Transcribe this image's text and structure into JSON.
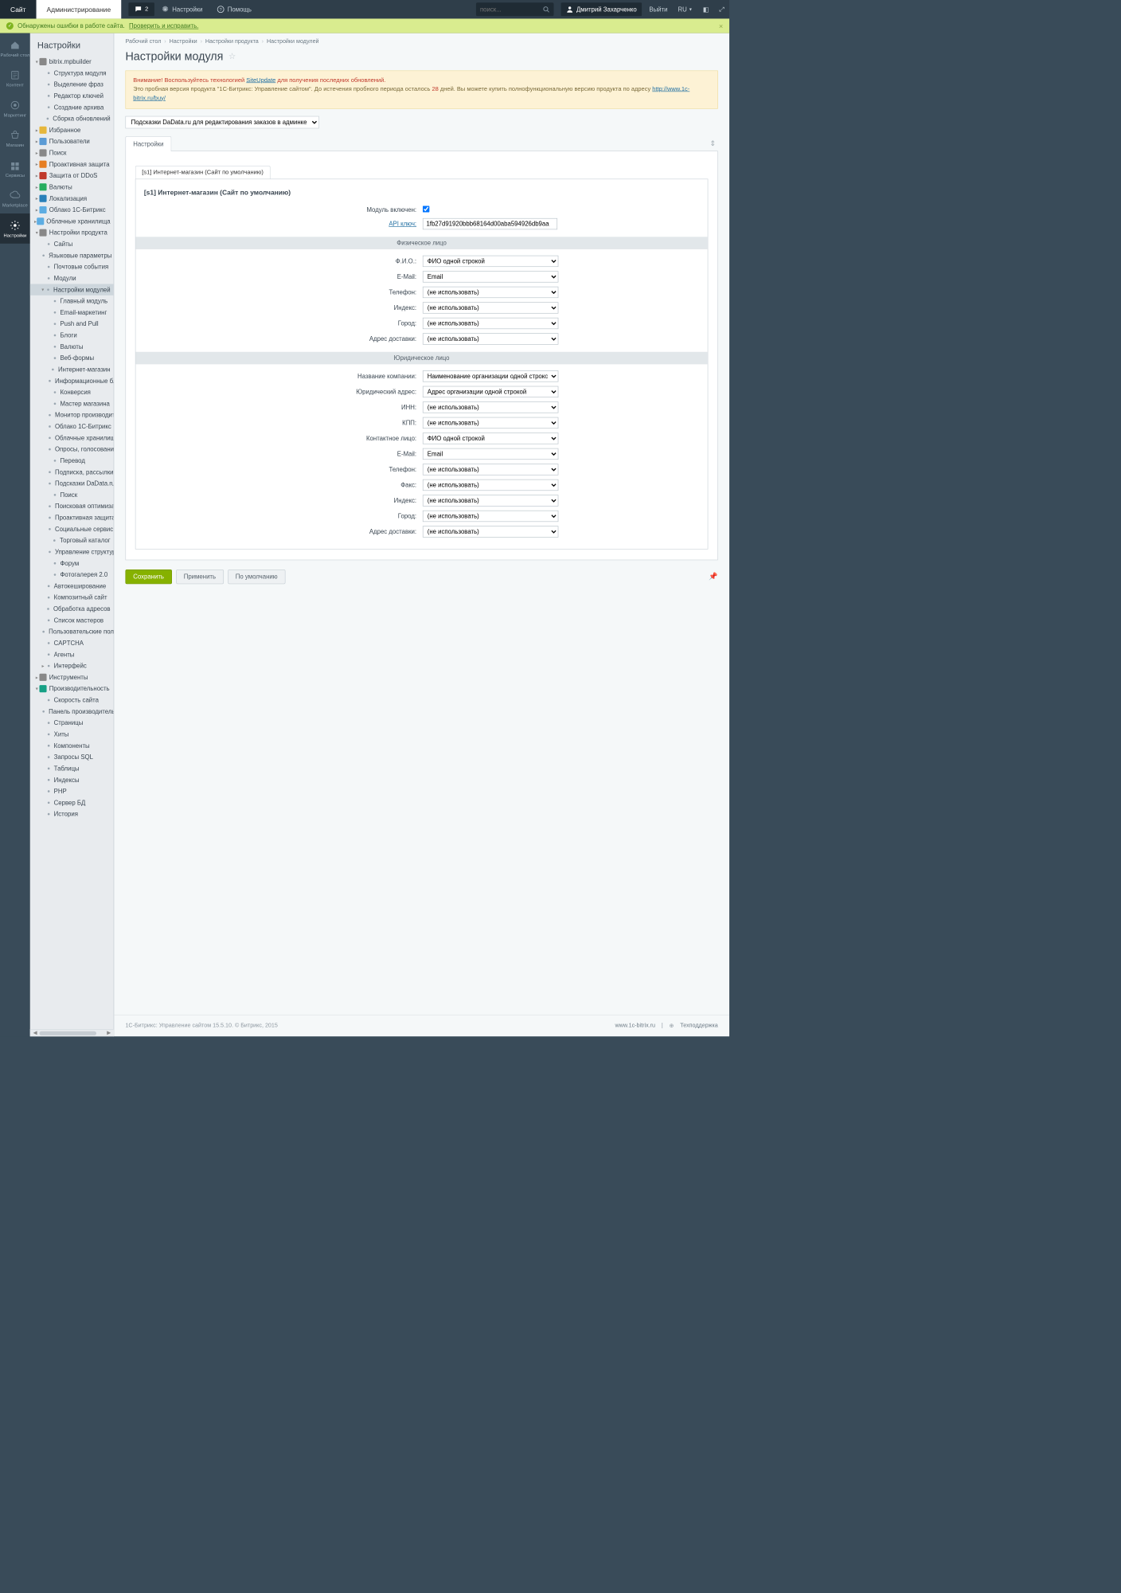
{
  "header": {
    "tab_site": "Сайт",
    "tab_admin": "Администрирование",
    "counter": "2",
    "settings": "Настройки",
    "help": "Помощь",
    "search_ph": "поиск...",
    "user": "Дмитрий Захарченко",
    "logout": "Выйти",
    "lang": "RU"
  },
  "notice": {
    "icon": "✓",
    "text": "Обнаружены ошибки в работе сайта.",
    "link": "Проверить и исправить."
  },
  "rail": [
    {
      "l": "Рабочий стол"
    },
    {
      "l": "Контент"
    },
    {
      "l": "Маркетинг"
    },
    {
      "l": "Магазин"
    },
    {
      "l": "Сервисы"
    },
    {
      "l": "Marketplace"
    },
    {
      "l": "Настройки"
    }
  ],
  "tree": {
    "title": "Настройки",
    "items": [
      {
        "l": "bitrix.mpbuilder",
        "lvl": 1,
        "exp": true,
        "ic": "pkg"
      },
      {
        "l": "Структура модуля",
        "lvl": 2,
        "dot": true
      },
      {
        "l": "Выделение фраз",
        "lvl": 2,
        "dot": true
      },
      {
        "l": "Редактор ключей",
        "lvl": 2,
        "dot": true
      },
      {
        "l": "Создание архива",
        "lvl": 2,
        "dot": true
      },
      {
        "l": "Сборка обновлений",
        "lvl": 2,
        "dot": true
      },
      {
        "l": "Избранное",
        "lvl": 1,
        "ic": "star",
        "ar": "r"
      },
      {
        "l": "Пользователи",
        "lvl": 1,
        "ic": "users",
        "ar": "r"
      },
      {
        "l": "Поиск",
        "lvl": 1,
        "ic": "search",
        "ar": "r"
      },
      {
        "l": "Проактивная защита",
        "lvl": 1,
        "ic": "shield",
        "ar": "r"
      },
      {
        "l": "Защита от DDoS",
        "lvl": 1,
        "ic": "ddos",
        "ar": "r"
      },
      {
        "l": "Валюты",
        "lvl": 1,
        "ic": "cur",
        "ar": "r"
      },
      {
        "l": "Локализация",
        "lvl": 1,
        "ic": "loc",
        "ar": "r"
      },
      {
        "l": "Облако 1С-Битрикс",
        "lvl": 1,
        "ic": "cloud",
        "ar": "r"
      },
      {
        "l": "Облачные хранилища",
        "lvl": 1,
        "ic": "cloud2",
        "ar": "r"
      },
      {
        "l": "Настройки продукта",
        "lvl": 1,
        "ic": "gear",
        "exp": true
      },
      {
        "l": "Сайты",
        "lvl": 2,
        "dot": true
      },
      {
        "l": "Языковые параметры",
        "lvl": 2,
        "dot": true
      },
      {
        "l": "Почтовые события",
        "lvl": 2,
        "dot": true
      },
      {
        "l": "Модули",
        "lvl": 2,
        "dot": true
      },
      {
        "l": "Настройки модулей",
        "lvl": 2,
        "dot": true,
        "sel": true,
        "exp": true
      },
      {
        "l": "Главный модуль",
        "lvl": 3,
        "dot": true
      },
      {
        "l": "Email-маркетинг",
        "lvl": 3,
        "dot": true
      },
      {
        "l": "Push and Pull",
        "lvl": 3,
        "dot": true
      },
      {
        "l": "Блоги",
        "lvl": 3,
        "dot": true
      },
      {
        "l": "Валюты",
        "lvl": 3,
        "dot": true
      },
      {
        "l": "Веб-формы",
        "lvl": 3,
        "dot": true
      },
      {
        "l": "Интернет-магазин",
        "lvl": 3,
        "dot": true
      },
      {
        "l": "Информационные блоки",
        "lvl": 3,
        "dot": true
      },
      {
        "l": "Конверсия",
        "lvl": 3,
        "dot": true
      },
      {
        "l": "Мастер магазина",
        "lvl": 3,
        "dot": true
      },
      {
        "l": "Монитор производительности",
        "lvl": 3,
        "dot": true
      },
      {
        "l": "Облако 1С-Битрикс",
        "lvl": 3,
        "dot": true
      },
      {
        "l": "Облачные хранилища",
        "lvl": 3,
        "dot": true
      },
      {
        "l": "Опросы, голосования",
        "lvl": 3,
        "dot": true
      },
      {
        "l": "Перевод",
        "lvl": 3,
        "dot": true
      },
      {
        "l": "Подписка, рассылки",
        "lvl": 3,
        "dot": true
      },
      {
        "l": "Подсказки DaData.ru для редактирования заказов в админке",
        "lvl": 3,
        "dot": true
      },
      {
        "l": "Поиск",
        "lvl": 3,
        "dot": true
      },
      {
        "l": "Поисковая оптимизация",
        "lvl": 3,
        "dot": true
      },
      {
        "l": "Проактивная защита",
        "lvl": 3,
        "dot": true
      },
      {
        "l": "Социальные сервисы",
        "lvl": 3,
        "dot": true
      },
      {
        "l": "Торговый каталог",
        "lvl": 3,
        "dot": true
      },
      {
        "l": "Управление структурой",
        "lvl": 3,
        "dot": true
      },
      {
        "l": "Форум",
        "lvl": 3,
        "dot": true
      },
      {
        "l": "Фотогалерея 2.0",
        "lvl": 3,
        "dot": true
      },
      {
        "l": "Автокеширование",
        "lvl": 2,
        "dot": true
      },
      {
        "l": "Композитный сайт",
        "lvl": 2,
        "dot": true
      },
      {
        "l": "Обработка адресов",
        "lvl": 2,
        "dot": true
      },
      {
        "l": "Список мастеров",
        "lvl": 2,
        "dot": true
      },
      {
        "l": "Пользовательские поля",
        "lvl": 2,
        "dot": true
      },
      {
        "l": "CAPTCHA",
        "lvl": 2,
        "dot": true
      },
      {
        "l": "Агенты",
        "lvl": 2,
        "dot": true
      },
      {
        "l": "Интерфейс",
        "lvl": 2,
        "dot": true,
        "ar": "r"
      },
      {
        "l": "Инструменты",
        "lvl": 1,
        "ic": "tool",
        "ar": "r"
      },
      {
        "l": "Производительность",
        "lvl": 1,
        "ic": "perf",
        "exp": true
      },
      {
        "l": "Скорость сайта",
        "lvl": 2,
        "dot": true
      },
      {
        "l": "Панель производительности",
        "lvl": 2,
        "dot": true
      },
      {
        "l": "Страницы",
        "lvl": 2,
        "dot": true
      },
      {
        "l": "Хиты",
        "lvl": 2,
        "dot": true
      },
      {
        "l": "Компоненты",
        "lvl": 2,
        "dot": true
      },
      {
        "l": "Запросы SQL",
        "lvl": 2,
        "dot": true
      },
      {
        "l": "Таблицы",
        "lvl": 2,
        "dot": true
      },
      {
        "l": "Индексы",
        "lvl": 2,
        "dot": true
      },
      {
        "l": "PHP",
        "lvl": 2,
        "dot": true
      },
      {
        "l": "Сервер БД",
        "lvl": 2,
        "dot": true
      },
      {
        "l": "История",
        "lvl": 2,
        "dot": true
      }
    ]
  },
  "breadcrumb": [
    "Рабочий стол",
    "Настройки",
    "Настройки продукта",
    "Настройки модулей"
  ],
  "page_title": "Настройки модуля",
  "alert": {
    "l1a": "Внимание! Воспользуйтесь технологией ",
    "l1link": "SiteUpdate",
    "l1b": " для получения последних обновлений.",
    "l2a": "Это пробная версия продукта \"1С-Битрикс: Управление сайтом\". До истечения пробного периода осталось ",
    "days": "28",
    "l2b": " дней. Вы можете купить полнофункциональную версию продукта по адресу ",
    "url": "http://www.1c-bitrix.ru/buy/"
  },
  "module_select": "Подсказки DaData.ru для редактирования заказов в админке",
  "tab": "Настройки",
  "subtab": "[s1] Интернет-магазин (Сайт по умолчанию)",
  "form": {
    "heading": "[s1] Интернет-магазин (Сайт по умолчанию)",
    "enabled_l": "Модуль включен:",
    "api_l": "API ключ:",
    "api_v": "1fb27d91920bbb68164d00aba594926db9aa",
    "sect1": "Физическое лицо",
    "phys": [
      {
        "l": "Ф.И.О.:",
        "v": "ФИО одной строкой"
      },
      {
        "l": "E-Mail:",
        "v": "Email"
      },
      {
        "l": "Телефон:",
        "v": "(не использовать)"
      },
      {
        "l": "Индекс:",
        "v": "(не использовать)"
      },
      {
        "l": "Город:",
        "v": "(не использовать)"
      },
      {
        "l": "Адрес доставки:",
        "v": "(не использовать)"
      }
    ],
    "sect2": "Юридическое лицо",
    "jur": [
      {
        "l": "Название компании:",
        "v": "Наименование организации одной строкой"
      },
      {
        "l": "Юридический адрес:",
        "v": "Адрес организации одной строкой"
      },
      {
        "l": "ИНН:",
        "v": "(не использовать)"
      },
      {
        "l": "КПП:",
        "v": "(не использовать)"
      },
      {
        "l": "Контактное лицо:",
        "v": "ФИО одной строкой"
      },
      {
        "l": "E-Mail:",
        "v": "Email"
      },
      {
        "l": "Телефон:",
        "v": "(не использовать)"
      },
      {
        "l": "Факс:",
        "v": "(не использовать)"
      },
      {
        "l": "Индекс:",
        "v": "(не использовать)"
      },
      {
        "l": "Город:",
        "v": "(не использовать)"
      },
      {
        "l": "Адрес доставки:",
        "v": "(не использовать)"
      }
    ]
  },
  "buttons": {
    "save": "Сохранить",
    "apply": "Применить",
    "default": "По умолчанию"
  },
  "footer": {
    "left": "1С-Битрикс: Управление сайтом 15.5.10. © Битрикс, 2015",
    "site": "www.1c-bitrix.ru",
    "support": "Техподдержка"
  }
}
